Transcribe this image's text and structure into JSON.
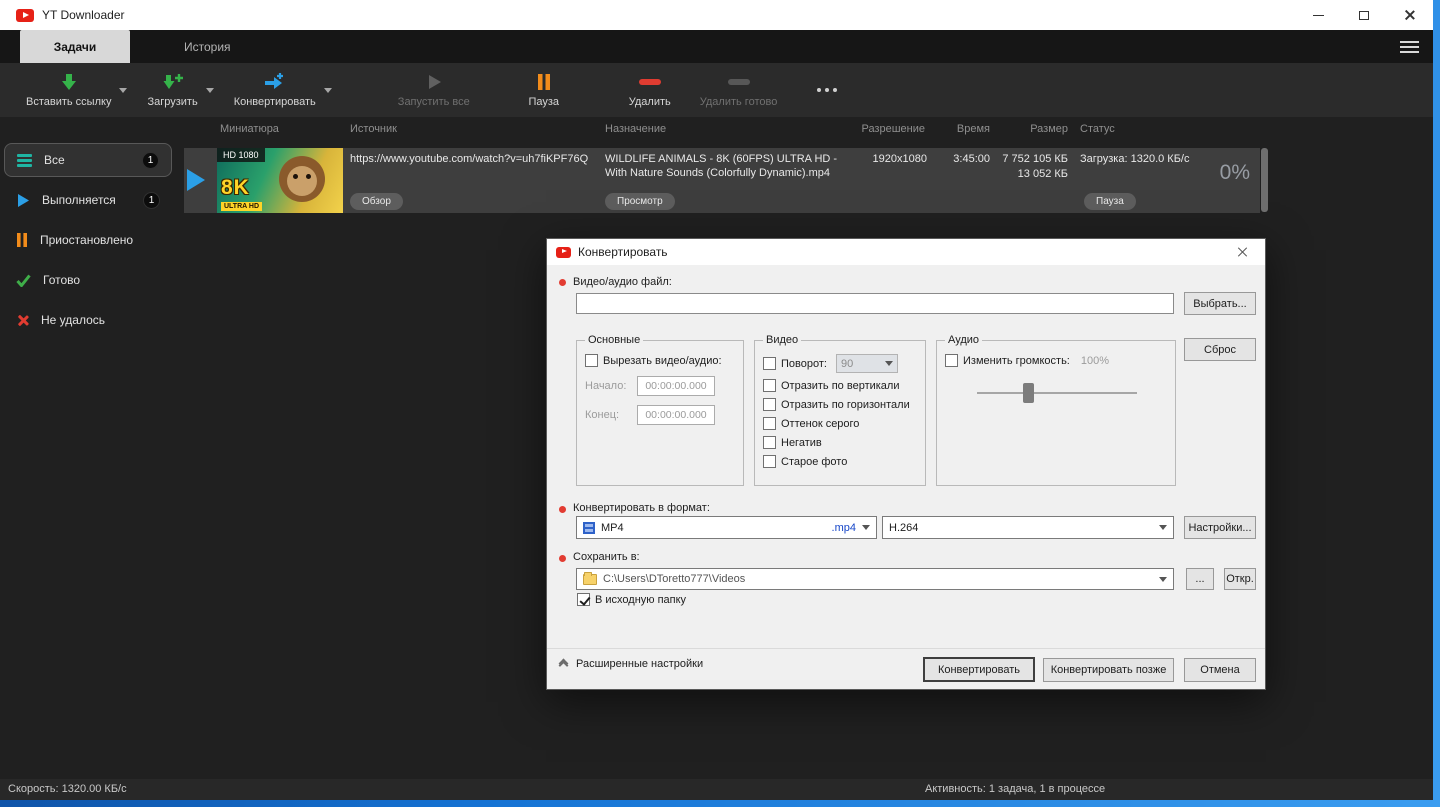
{
  "window": {
    "title": "YT Downloader"
  },
  "tabs": [
    {
      "label": "Задачи",
      "active": true
    },
    {
      "label": "История",
      "active": false
    }
  ],
  "toolbar": {
    "paste_link": "Вставить ссылку",
    "download": "Загрузить",
    "convert": "Конвертировать",
    "start_all": "Запустить все",
    "pause": "Пауза",
    "delete": "Удалить",
    "delete_done": "Удалить готово"
  },
  "sidebar": {
    "items": [
      {
        "label": "Все",
        "badge": "1"
      },
      {
        "label": "Выполняется",
        "badge": "1"
      },
      {
        "label": "Приостановлено",
        "badge": ""
      },
      {
        "label": "Готово",
        "badge": ""
      },
      {
        "label": "Не удалось",
        "badge": ""
      }
    ]
  },
  "table": {
    "headers": [
      "Миниатюра",
      "Источник",
      "Назначение",
      "Разрешение",
      "Время",
      "Размер",
      "Статус"
    ],
    "row": {
      "thumb_quality": "HD 1080",
      "thumb_8k": "8K",
      "thumb_ultra": "ULTRA HD",
      "source_url": "https://www.youtube.com/watch?v=uh7fiKPF76Q",
      "source_button": "Обзор",
      "dest_name": "WILDLIFE ANIMALS - 8K (60FPS) ULTRA HD - With Nature Sounds (Colorfully Dynamic).mp4",
      "dest_button": "Просмотр",
      "resolution": "1920x1080",
      "time": "3:45:00",
      "size_total": "7 752 105 КБ",
      "size_done": "13 052 КБ",
      "status": "Загрузка: 1320.0 КБ/с",
      "status_button": "Пауза",
      "progress": "0%"
    }
  },
  "dialog": {
    "title": "Конвертировать",
    "file_label": "Видео/аудио файл:",
    "file_value": "",
    "choose_button": "Выбрать...",
    "groups": {
      "main": {
        "title": "Основные",
        "cut_checkbox": "Вырезать видео/аудио:",
        "start_label": "Начало:",
        "start_value": "00:00:00.000",
        "end_label": "Конец:",
        "end_value": "00:00:00.000"
      },
      "video": {
        "title": "Видео",
        "rotate_checkbox": "Поворот:",
        "rotate_value": "90",
        "options": [
          "Отразить по вертикали",
          "Отразить по горизонтали",
          "Оттенок серого",
          "Негатив",
          "Старое фото"
        ]
      },
      "audio": {
        "title": "Аудио",
        "volume_checkbox": "Изменить громкость:",
        "volume_value": "100%"
      }
    },
    "reset_button": "Сброс",
    "format_label": "Конвертировать в формат:",
    "format_value": "MP4",
    "format_ext": ".mp4",
    "codec_value": "H.264",
    "settings_button": "Настройки...",
    "save_label": "Сохранить в:",
    "save_path": "C:\\Users\\DToretto777\\Videos",
    "browse_button": "...",
    "open_button": "Откр.",
    "same_folder_checkbox": "В исходную папку",
    "advanced_label": "Расширенные настройки",
    "convert_button": "Конвертировать",
    "convert_later_button": "Конвертировать позже",
    "cancel_button": "Отмена"
  },
  "statusbar": {
    "speed": "Скорость: 1320.00 КБ/с",
    "activity": "Активность: 1 задача, 1 в процессе"
  },
  "colors": {
    "accent_green": "#35b34a",
    "accent_blue": "#2b9fe6",
    "accent_orange": "#f28c1b",
    "accent_red": "#e03c31"
  }
}
